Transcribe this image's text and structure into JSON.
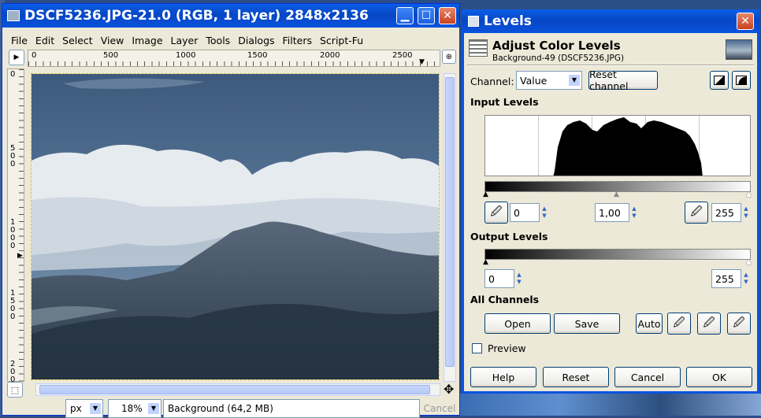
{
  "image_window": {
    "title": "DSCF5236.JPG-21.0 (RGB, 1 layer) 2848x2136",
    "menu": [
      "File",
      "Edit",
      "Select",
      "View",
      "Image",
      "Layer",
      "Tools",
      "Dialogs",
      "Filters",
      "Script-Fu"
    ],
    "ruler_top": [
      "0",
      "500",
      "1000",
      "1500",
      "2000",
      "2500"
    ],
    "ruler_left": [
      "0",
      "5\n0\n0",
      "1\n0\n0\n0",
      "1\n5\n0\n0",
      "2\n0\n0"
    ],
    "unit": "px",
    "zoom": "18%",
    "status": "Background (64,2 MB)",
    "cancel": "Cancel"
  },
  "levels": {
    "window_title": "Levels",
    "heading": "Adjust Color Levels",
    "subheading": "Background-49 (DSCF5236.JPG)",
    "channel_label": "Channel:",
    "channel_value": "Value",
    "reset_channel": "Reset channel",
    "input_levels": "Input Levels",
    "input_low": "0",
    "input_gamma": "1,00",
    "input_high": "255",
    "output_levels": "Output Levels",
    "output_low": "0",
    "output_high": "255",
    "all_channels": "All Channels",
    "open": "Open",
    "save": "Save",
    "auto": "Auto",
    "preview": "Preview",
    "preview_checked": false,
    "help": "Help",
    "reset": "Reset",
    "cancel": "Cancel",
    "ok": "OK"
  },
  "colors": {
    "xp_blue": "#0a53de",
    "dialog_bg": "#ece9d8"
  }
}
